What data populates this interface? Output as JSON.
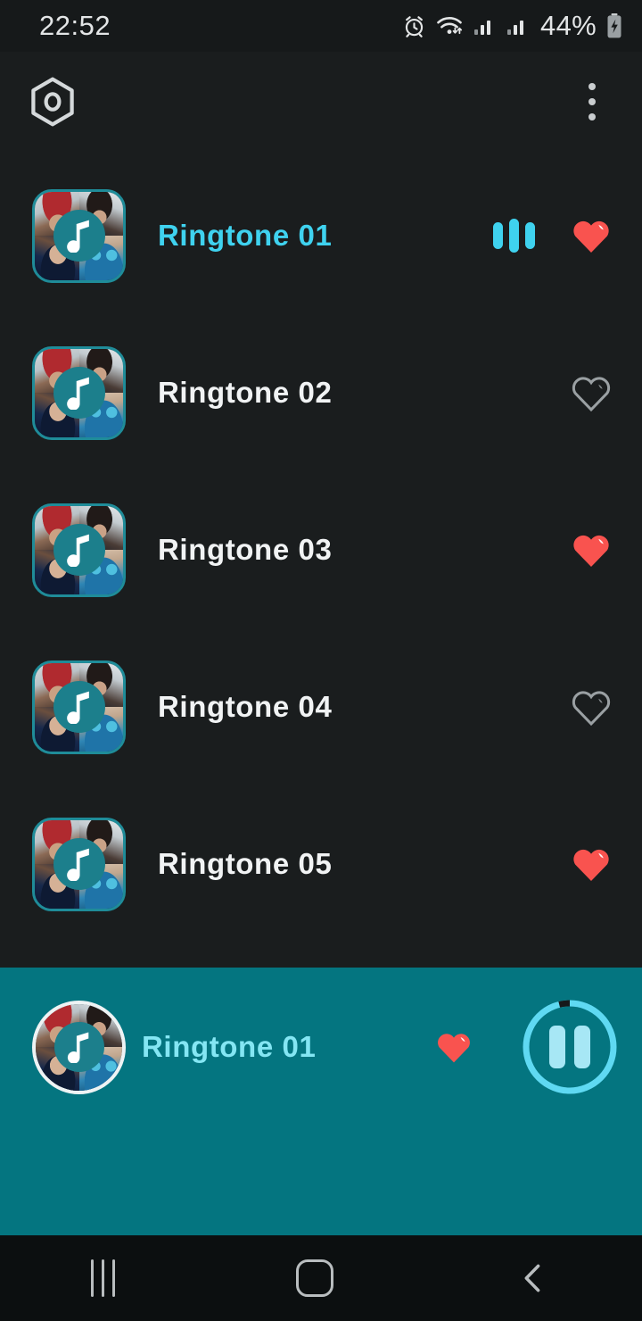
{
  "status_bar": {
    "time": "22:52",
    "battery_percent": "44%",
    "icons": [
      "alarm-icon",
      "wifi-icon",
      "signal-sim1-icon",
      "signal-sim2-icon",
      "battery-charging-icon"
    ]
  },
  "app_bar": {
    "settings_icon": "hexagon-settings-icon",
    "overflow_icon": "more-vertical-icon"
  },
  "list": {
    "rows": [
      {
        "title": "Ringtone 01",
        "favorite": true,
        "playing": true,
        "thumb": "collage-thumbnail"
      },
      {
        "title": "Ringtone 02",
        "favorite": false,
        "playing": false,
        "thumb": "collage-thumbnail"
      },
      {
        "title": "Ringtone 03",
        "favorite": true,
        "playing": false,
        "thumb": "collage-thumbnail"
      },
      {
        "title": "Ringtone 04",
        "favorite": false,
        "playing": false,
        "thumb": "collage-thumbnail"
      },
      {
        "title": "Ringtone 05",
        "favorite": true,
        "playing": false,
        "thumb": "collage-thumbnail"
      }
    ]
  },
  "player": {
    "title": "Ringtone 01",
    "favorite": true,
    "state": "playing",
    "control_icon": "pause-icon",
    "progress_percent": 4,
    "art": "collage-disc-art"
  },
  "nav_bar": {
    "recents_label": "recents-icon",
    "home_label": "home-icon",
    "back_label": "back-icon"
  },
  "colors": {
    "background": "#1a1d1e",
    "teal": "#047580",
    "accent_cyan": "#3fd2ef",
    "player_text": "#84e6f3",
    "heart_filled": "#f9534f",
    "heart_outline": "#9aa0a3",
    "title_text": "#f1f3f4"
  }
}
